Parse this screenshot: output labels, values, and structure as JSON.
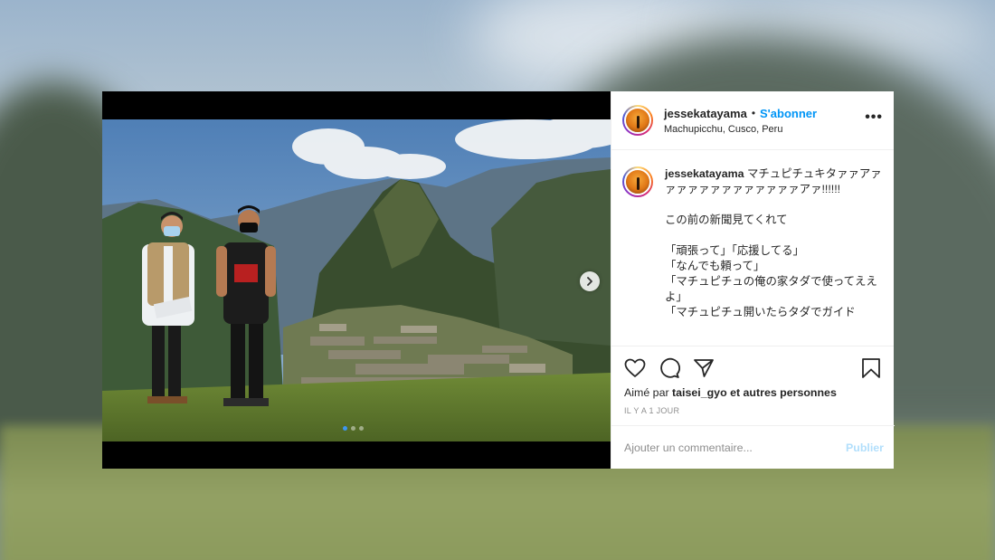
{
  "post": {
    "username": "jessekatayama",
    "follow_label": "S'abonner",
    "separator": "•",
    "location": "Machupicchu, Cusco, Peru",
    "more_label": "•••",
    "caption_username": "jessekatayama",
    "caption_text": "マチュピチュキタァァアァァァァァァァァァァァァァアァ!!!!!!\n\nこの前の新聞見てくれて\n\n「頑張って」「応援してる」\n「なんでも頼って」\n「マチュピチュの俺の家タダで使ってええよ」\n「マチュピチュ開いたらタダでガイド",
    "likes_prefix": "Aimé par ",
    "likes_user": "taisei_gyo",
    "likes_suffix": " et autres personnes",
    "time": "IL Y A 1 JOUR",
    "comment_placeholder": "Ajouter un commentaire...",
    "publish_label": "Publier",
    "carousel_count": 3,
    "carousel_active": 1
  },
  "icons": {
    "like": "heart-icon",
    "comment": "comment-icon",
    "share": "paper-plane-icon",
    "save": "bookmark-icon",
    "next": "chevron-right-icon"
  },
  "colors": {
    "follow": "#0095f6",
    "publish_disabled": "#b2dffc",
    "muted": "#8e8e8e",
    "text": "#262626"
  }
}
